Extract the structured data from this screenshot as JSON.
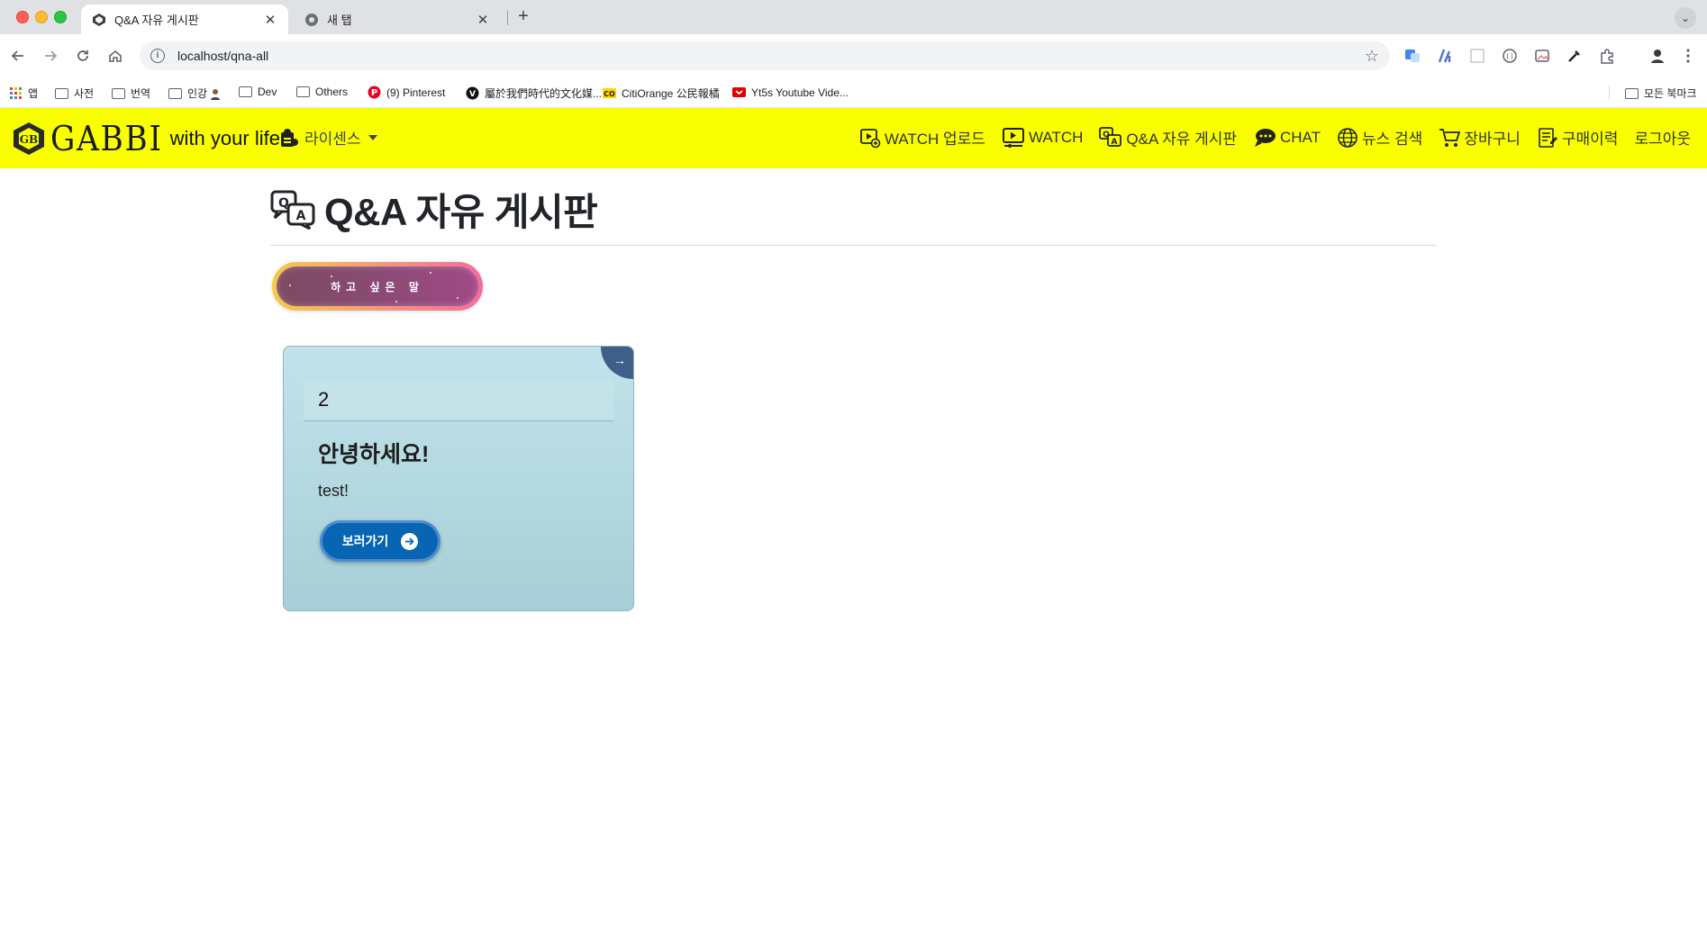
{
  "browser": {
    "tabs": [
      {
        "title": "Q&A 자유 게시판",
        "active": true
      },
      {
        "title": "새 탭",
        "active": false
      }
    ],
    "url": "localhost/qna-all",
    "bookmarks": [
      {
        "label": "앱",
        "kind": "apps"
      },
      {
        "label": "사전",
        "kind": "folder"
      },
      {
        "label": "번역",
        "kind": "folder"
      },
      {
        "label": "인강",
        "kind": "folder"
      },
      {
        "label": "Dev",
        "kind": "folder"
      },
      {
        "label": "Others",
        "kind": "folder"
      },
      {
        "label": "(9) Pinterest",
        "kind": "pinterest"
      },
      {
        "label": "屬於我們時代的文化媒...",
        "kind": "v-site"
      },
      {
        "label": "CitiOrange 公民報橘",
        "kind": "citiorange"
      },
      {
        "label": "Yt5s Youtube Vide...",
        "kind": "yt5s"
      }
    ],
    "all_bookmarks": "모든 북마크"
  },
  "site": {
    "brand_word": "GABBI",
    "brand_tagline": "with your life",
    "license_menu": "라이센스",
    "nav": [
      {
        "label": "WATCH 업로드",
        "icon": "watch-upload-icon"
      },
      {
        "label": "WATCH",
        "icon": "watch-icon"
      },
      {
        "label": "Q&A 자유 게시판",
        "icon": "qna-icon"
      },
      {
        "label": "CHAT",
        "icon": "chat-icon"
      },
      {
        "label": "뉴스 검색",
        "icon": "globe-icon"
      },
      {
        "label": "장바구니",
        "icon": "cart-icon"
      },
      {
        "label": "구매이력",
        "icon": "receipt-icon"
      },
      {
        "label": "로그아웃",
        "icon": ""
      }
    ]
  },
  "page": {
    "title": "Q&A 자유 게시판",
    "write_button": "하고 싶은 말"
  },
  "posts": [
    {
      "number": "2",
      "title": "안녕하세요!",
      "body": "test!",
      "button": "보러가기"
    }
  ]
}
